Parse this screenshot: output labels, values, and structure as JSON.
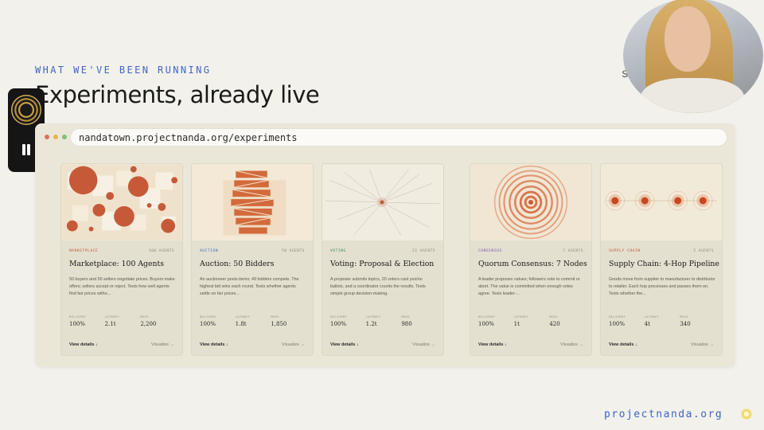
{
  "heading": {
    "eyebrow": "WHAT WE'VE BEEN RUNNING",
    "title": "Experiments, already live"
  },
  "side_copy": "Set up a … agents, get … s.",
  "browser": {
    "url": "nandatown.projectnanda.org/experiments",
    "dot_colors": [
      "#e0705a",
      "#e8b64c",
      "#7fbf7a"
    ]
  },
  "cards": [
    {
      "category": "MARKETPLACE",
      "category_color": "#c0503a",
      "agents": "100 AGENTS",
      "title": "Marketplace: 100 Agents",
      "description": "50 buyers and 50 sellers negotiate prices. Buyers make offers; sellers accept or reject. Tests how well agents find fair prices witho...",
      "stats": [
        {
          "label": "DELIVERY",
          "value": "100%"
        },
        {
          "label": "LATENCY",
          "value": "2.1t"
        },
        {
          "label": "MSGS",
          "value": "2,200"
        }
      ],
      "details_label": "View details ↓",
      "visualize_label": "Visualize →"
    },
    {
      "category": "AUCTION",
      "category_color": "#3f66c0",
      "agents": "50 AGENTS",
      "title": "Auction: 50 Bidders",
      "description": "An auctioneer posts items; 49 bidders compete. The highest bid wins each round. Tests whether agents settle on fair prices...",
      "stats": [
        {
          "label": "DELIVERY",
          "value": "100%"
        },
        {
          "label": "LATENCY",
          "value": "1.8t"
        },
        {
          "label": "MSGS",
          "value": "1,850"
        }
      ],
      "details_label": "View details ↓",
      "visualize_label": "Visualize →"
    },
    {
      "category": "VOTING",
      "category_color": "#3a8a5a",
      "agents": "21 AGENTS",
      "title": "Voting: Proposal & Election",
      "description": "A proposer submits topics, 20 voters cast yes/no ballots, and a coordinator counts the results. Tests simple group decision-making.",
      "stats": [
        {
          "label": "DELIVERY",
          "value": "100%"
        },
        {
          "label": "LATENCY",
          "value": "1.2t"
        },
        {
          "label": "MSGS",
          "value": "980"
        }
      ],
      "details_label": "View details ↓",
      "visualize_label": "Visualize →"
    },
    {
      "category": "CONSENSUS",
      "category_color": "#7a4fb5",
      "agents": "7 AGENTS",
      "title": "Quorum Consensus: 7 Nodes",
      "description": "A leader proposes values; followers vote to commit or abort. The value is committed when enough votes agree. Tests leader-...",
      "stats": [
        {
          "label": "DELIVERY",
          "value": "100%"
        },
        {
          "label": "LATENCY",
          "value": "1t"
        },
        {
          "label": "MSGS",
          "value": "420"
        }
      ],
      "details_label": "View details ↓",
      "visualize_label": "Visualize →"
    },
    {
      "category": "SUPPLY CHAIN",
      "category_color": "#c0503a",
      "agents": "5 AGENTS",
      "title": "Supply Chain: 4-Hop Pipeline",
      "description": "Goods move from supplier to manufacturer to distributor to retailer. Each hop processes and passes them on. Tests whether the...",
      "stats": [
        {
          "label": "DELIVERY",
          "value": "100%"
        },
        {
          "label": "LATENCY",
          "value": "4t"
        },
        {
          "label": "MSGS",
          "value": "340"
        }
      ],
      "details_label": "View details ↓",
      "visualize_label": "Visualize →"
    }
  ],
  "footer": {
    "brand": "projectnanda.org",
    "accent": "#3f66c0"
  },
  "icons": {
    "recorder_avatar": "recording-avatar-icon",
    "pause": "pause-icon",
    "brand_mark": "sun-logo-icon"
  }
}
